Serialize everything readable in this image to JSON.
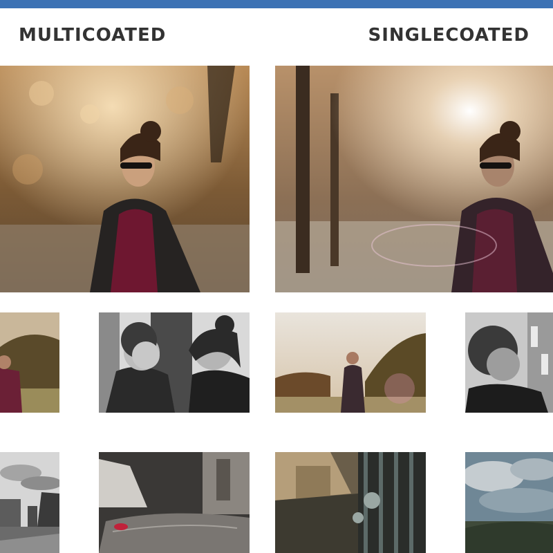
{
  "headings": {
    "left": "MULTICOATED",
    "right": "SINGLECOATED"
  },
  "colors": {
    "top_bar": "#3d72b4",
    "heading_text": "#333333",
    "background": "#ffffff"
  },
  "photos": [
    "autumn-portrait-multicoated",
    "autumn-portrait-singlecoated-flare",
    "field-portrait-crop",
    "mother-and-child-bw",
    "field-portrait-flare",
    "child-bw-crop",
    "city-skyline-bw",
    "car-hood-rose-petal",
    "building-reflection",
    "cloudy-sky-crop"
  ]
}
